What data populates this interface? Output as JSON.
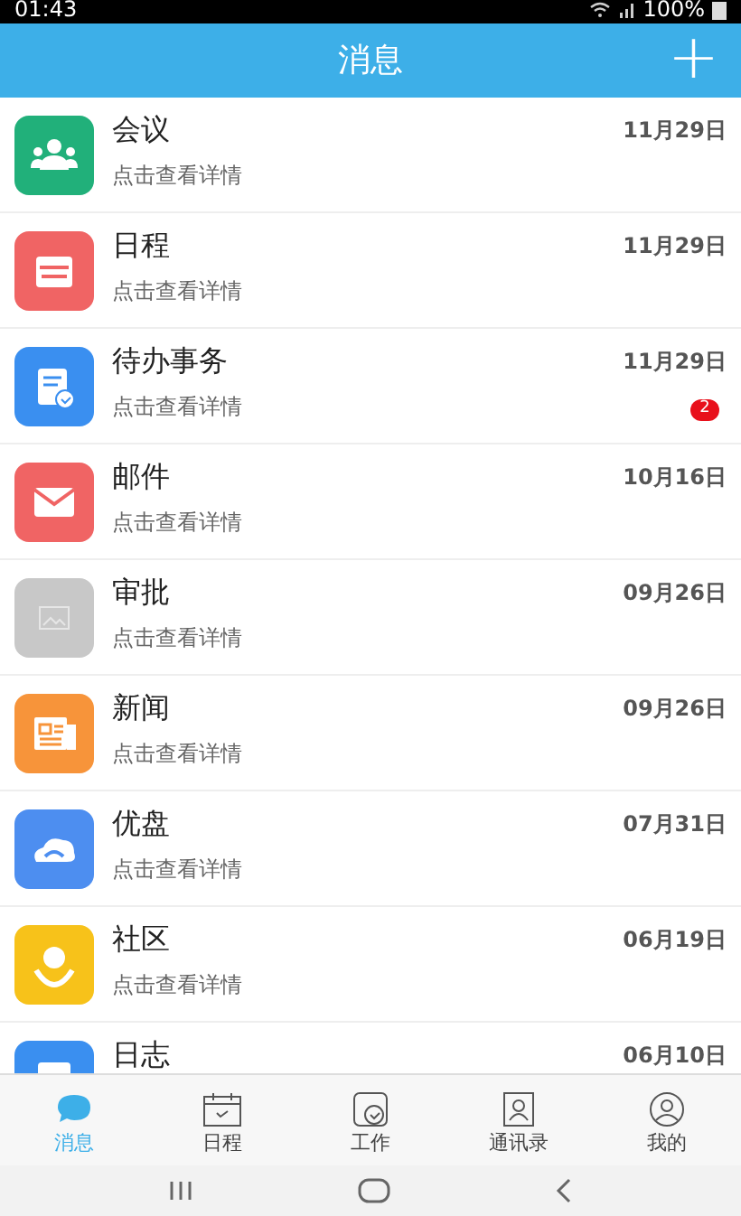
{
  "status_bar": {
    "time": "01:43",
    "battery": "100%"
  },
  "header": {
    "title": "消息",
    "add": "+"
  },
  "messages": [
    {
      "kind": "meeting",
      "title": "会议",
      "subtitle": "点击查看详情",
      "date": "11月29日"
    },
    {
      "kind": "schedule",
      "title": "日程",
      "subtitle": "点击查看详情",
      "date": "11月29日"
    },
    {
      "kind": "todo",
      "title": "待办事务",
      "subtitle": "点击查看详情",
      "date": "11月29日",
      "badge": "2"
    },
    {
      "kind": "mail",
      "title": "邮件",
      "subtitle": "点击查看详情",
      "date": "10月16日"
    },
    {
      "kind": "approval",
      "title": "审批",
      "subtitle": "点击查看详情",
      "date": "09月26日"
    },
    {
      "kind": "news",
      "title": "新闻",
      "subtitle": "点击查看详情",
      "date": "09月26日"
    },
    {
      "kind": "drive",
      "title": "优盘",
      "subtitle": "点击查看详情",
      "date": "07月31日"
    },
    {
      "kind": "community",
      "title": "社区",
      "subtitle": "点击查看详情",
      "date": "06月19日"
    },
    {
      "kind": "log",
      "title": "日志",
      "date": "06月10日"
    }
  ],
  "tabs": [
    {
      "kind": "chat",
      "label": "消息",
      "selected": true
    },
    {
      "kind": "calendar",
      "label": "日程",
      "selected": false
    },
    {
      "kind": "work",
      "label": "工作",
      "selected": false
    },
    {
      "kind": "contacts",
      "label": "通讯录",
      "selected": false
    },
    {
      "kind": "profile",
      "label": "我的",
      "selected": false
    }
  ]
}
